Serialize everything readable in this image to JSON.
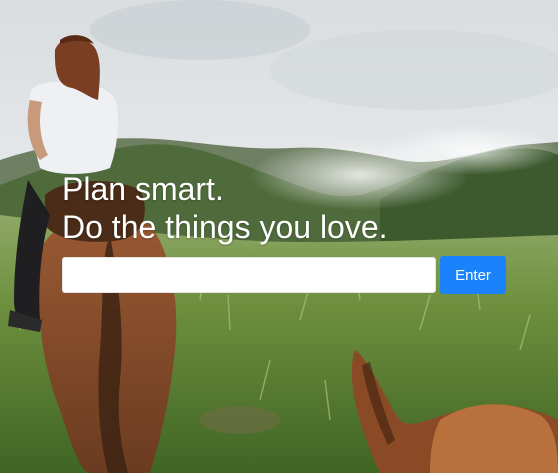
{
  "hero": {
    "headline_line1": "Plan smart.",
    "headline_line2": "Do the things you love."
  },
  "form": {
    "email_value": "",
    "email_placeholder": "",
    "submit_label": "Enter"
  },
  "colors": {
    "button": "#1a82fb",
    "headline_text": "#ffffff",
    "input_background": "#ffffff"
  }
}
